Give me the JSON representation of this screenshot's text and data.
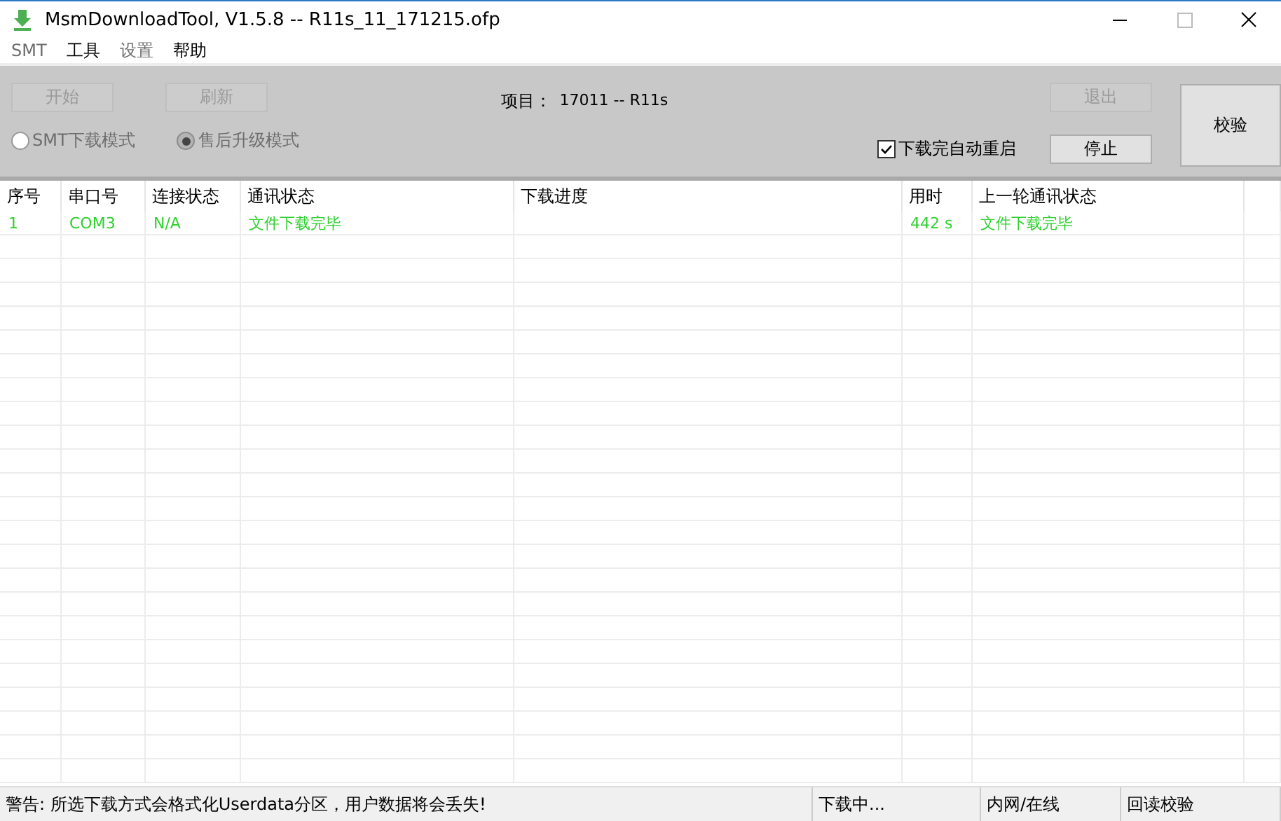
{
  "window": {
    "title": "MsmDownloadTool, V1.5.8 -- R11s_11_171215.ofp"
  },
  "menu": [
    {
      "label": "SMT",
      "disabled": true
    },
    {
      "label": "工具",
      "disabled": false
    },
    {
      "label": "设置",
      "disabled": true
    },
    {
      "label": "帮助",
      "disabled": false
    }
  ],
  "toolbar": {
    "start_button": {
      "label": "开始",
      "disabled": true
    },
    "refresh_button": {
      "label": "刷新",
      "disabled": true
    },
    "project_label": "项目：",
    "project_value": "17011 -- R11s",
    "exit_button": {
      "label": "退出",
      "disabled": true
    },
    "stop_button": {
      "label": "停止",
      "disabled": false
    },
    "verify_button": {
      "label": "校验",
      "disabled": false
    },
    "modes": [
      {
        "label": "SMT下载模式",
        "selected": false,
        "disabled": true
      },
      {
        "label": "售后升级模式",
        "selected": true,
        "disabled": true
      }
    ],
    "auto_restart": {
      "label": "下载完自动重启",
      "checked": true
    }
  },
  "table": {
    "columns": [
      "序号",
      "串口号",
      "连接状态",
      "通讯状态",
      "下载进度",
      "用时",
      "上一轮通讯状态"
    ],
    "rows": [
      [
        "1",
        "COM3",
        "N/A",
        "文件下载完毕",
        "",
        "442 s",
        "文件下载完毕"
      ]
    ]
  },
  "status_bar": [
    "警告: 所选下载方式会格式化Userdata分区，用户数据将会丢失!",
    "下载中...",
    "内网/在线",
    "回读校验"
  ]
}
